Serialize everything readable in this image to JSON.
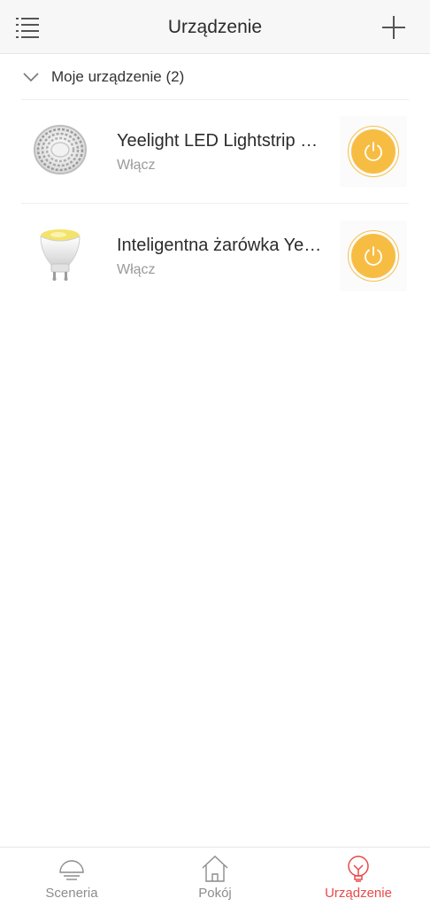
{
  "header": {
    "title": "Urządzenie",
    "menu_icon": "list-menu-icon",
    "add_icon": "plus-icon"
  },
  "group": {
    "label": "Moje urządzenie (2)",
    "icon": "chevron-down-icon"
  },
  "devices": [
    {
      "name": "Yeelight LED Lightstrip Plus",
      "status": "Włącz",
      "icon": "led-strip-icon",
      "power_on": true
    },
    {
      "name": "Inteligentna żarówka Yeelight",
      "status": "Włącz",
      "icon": "gu10-bulb-icon",
      "power_on": true
    }
  ],
  "tabs": [
    {
      "label": "Sceneria",
      "icon": "scene-lamp-icon",
      "active": false
    },
    {
      "label": "Pokój",
      "icon": "home-icon",
      "active": false
    },
    {
      "label": "Urządzenie",
      "icon": "bulb-icon",
      "active": true
    }
  ],
  "colors": {
    "accent": "#e84a4a",
    "power": "#f7bd43",
    "inactive_tab": "#8c8c8c"
  }
}
